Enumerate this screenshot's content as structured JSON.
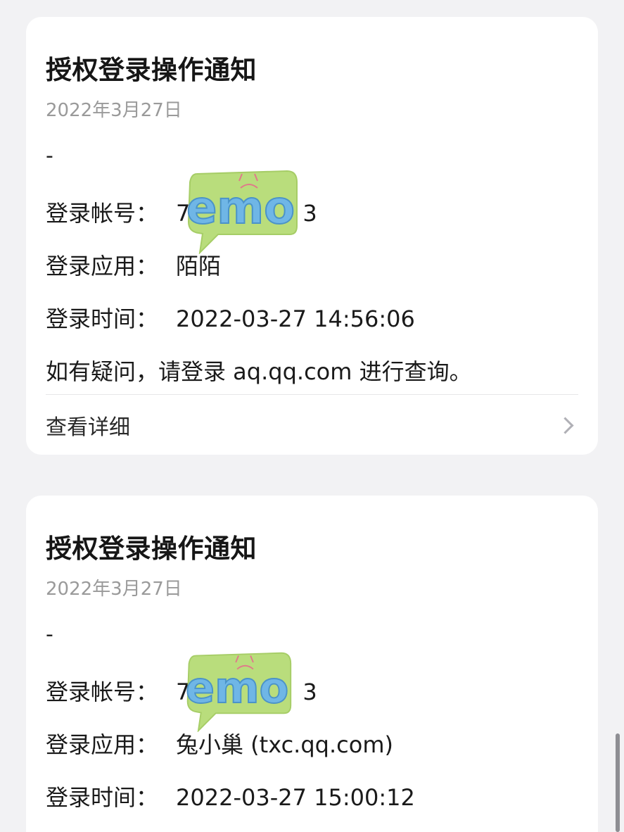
{
  "notifications": [
    {
      "title": "授权登录操作通知",
      "date": "2022年3月27日",
      "separator": "-",
      "account_label": "登录帐号：",
      "account_first": "7",
      "account_last": "3",
      "app_label": "登录应用：",
      "app_value": "陌陌",
      "time_label": "登录时间：",
      "time_value": "2022-03-27 14:56:06",
      "notice": "如有疑问，请登录 aq.qq.com 进行查询。",
      "detail_label": "查看详细",
      "sticker_text": "emo"
    },
    {
      "title": "授权登录操作通知",
      "date": "2022年3月27日",
      "separator": "-",
      "account_label": "登录帐号：",
      "account_first": "7",
      "account_last": "3",
      "app_label": "登录应用：",
      "app_value": "兔小巢 (txc.qq.com)",
      "time_label": "登录时间：",
      "time_value": "2022-03-27 15:00:12",
      "sticker_text": "emo"
    }
  ],
  "colors": {
    "background": "#f2f2f4",
    "card": "#ffffff",
    "title": "#161616",
    "date": "#9a9a9a",
    "sticker_green": "#b9dd7c",
    "sticker_letters": "#6fb6e6"
  },
  "icons": {
    "detail_chevron": "chevron-right-icon",
    "sticker": "emo-sticker-icon"
  }
}
